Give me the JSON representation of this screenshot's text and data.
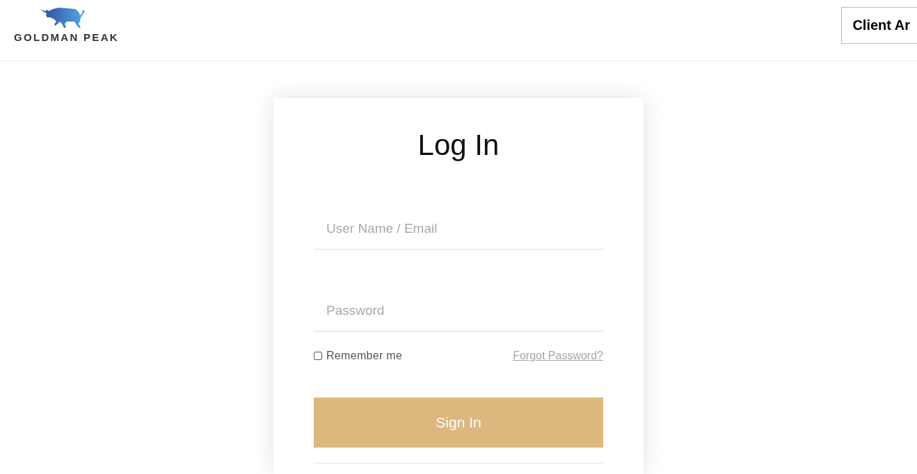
{
  "header": {
    "logo_text": "GOLDMAN PEAK",
    "client_area_button": "Client Ar"
  },
  "login": {
    "title": "Log In",
    "fields": [
      {
        "placeholder": "User Name / Email"
      },
      {
        "placeholder": "Password"
      }
    ],
    "remember": {
      "label": "Remember me",
      "checked": false
    },
    "forgot_link": "Forgot Password?",
    "submit": "Sign In"
  }
}
